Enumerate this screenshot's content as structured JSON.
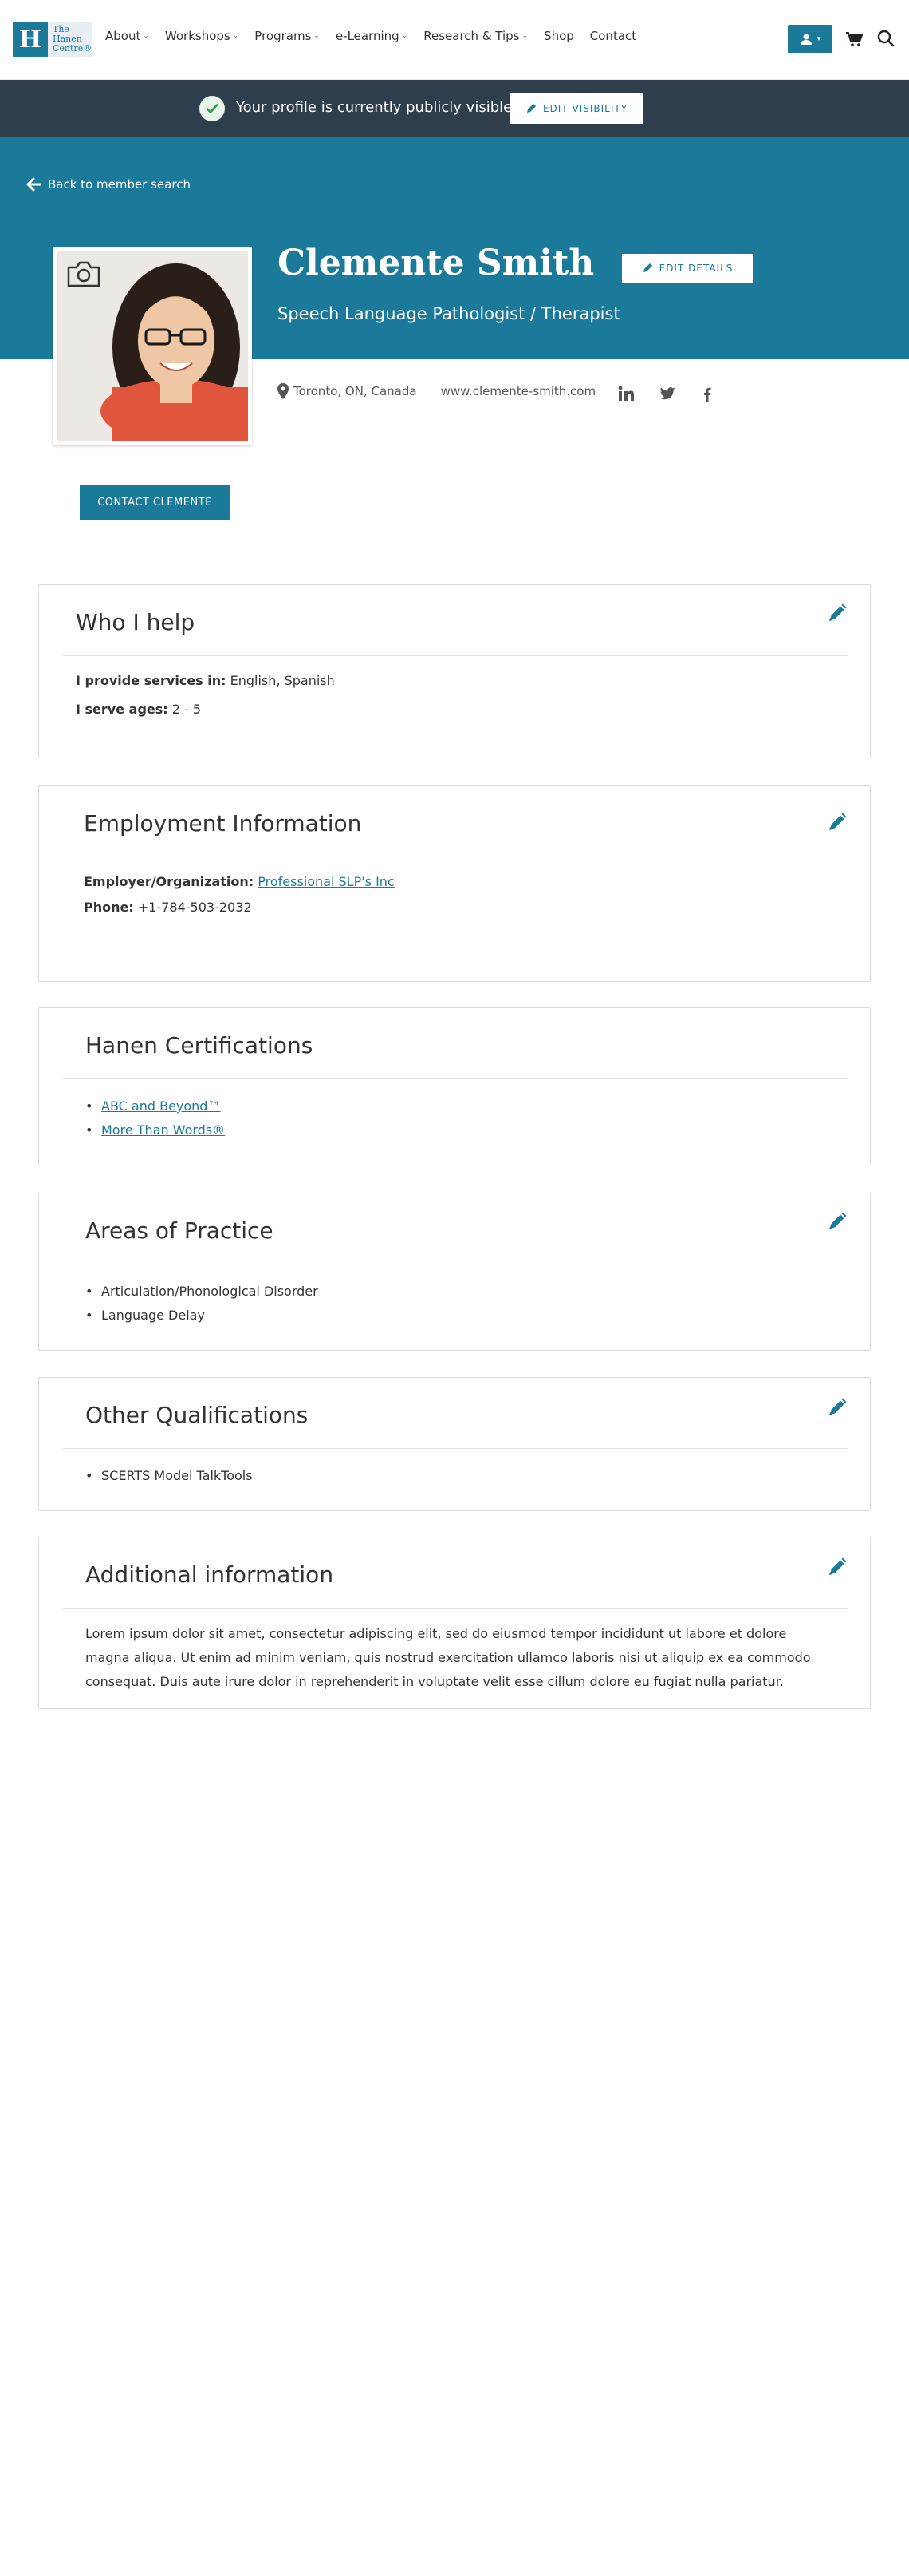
{
  "logo": {
    "mark": "H",
    "text": "The Hanen Centre®"
  },
  "nav": {
    "items": [
      {
        "label": "About",
        "dropdown": true
      },
      {
        "label": "Workshops",
        "dropdown": true
      },
      {
        "label": "Programs",
        "dropdown": true
      },
      {
        "label": "e-Learning",
        "dropdown": true
      },
      {
        "label": "Research & Tips",
        "dropdown": true
      },
      {
        "label": "Shop",
        "dropdown": false
      },
      {
        "label": "Contact",
        "dropdown": false
      }
    ]
  },
  "banner": {
    "message": "Your profile is currently publicly visible.",
    "button": "EDIT VISIBILITY"
  },
  "profile": {
    "back_link": "Back to member search",
    "name": "Clemente Smith",
    "title": "Speech Language Pathologist / Therapist",
    "edit_button": "EDIT DETAILS",
    "location": "Toronto, ON, Canada",
    "website": "www.clemente-smith.com",
    "contact_button": "CONTACT CLEMENTE"
  },
  "who_i_help": {
    "title": "Who I help",
    "services_label": "I provide services in:",
    "services_value": "English, Spanish",
    "ages_label": "I serve ages:",
    "ages_value": "2 - 5"
  },
  "employment": {
    "title": "Employment Information",
    "employer_label": "Employer/Organization:",
    "employer_value": "Professional SLP's Inc",
    "phone_label": "Phone:",
    "phone_value": "+1-784-503-2032"
  },
  "certifications": {
    "title": "Hanen Certifications",
    "items": [
      "ABC and Beyond™",
      "More Than Words®"
    ]
  },
  "practice": {
    "title": "Areas of Practice",
    "items": [
      "Articulation/Phonological Disorder",
      "Language Delay"
    ]
  },
  "qualifications": {
    "title": "Other Qualifications",
    "items": [
      "SCERTS Model TalkTools"
    ]
  },
  "additional": {
    "title": "Additional information",
    "text": "Lorem ipsum dolor sit amet, consectetur adipiscing elit, sed do eiusmod tempor incididunt ut labore et dolore magna aliqua. Ut enim ad minim veniam, quis nostrud exercitation ullamco laboris nisi ut aliquip ex ea commodo consequat. Duis aute irure dolor in reprehenderit in voluptate velit esse cillum dolore eu fugiat nulla pariatur."
  },
  "colors": {
    "brand": "#1b7a99",
    "banner": "#2f3e4c"
  }
}
